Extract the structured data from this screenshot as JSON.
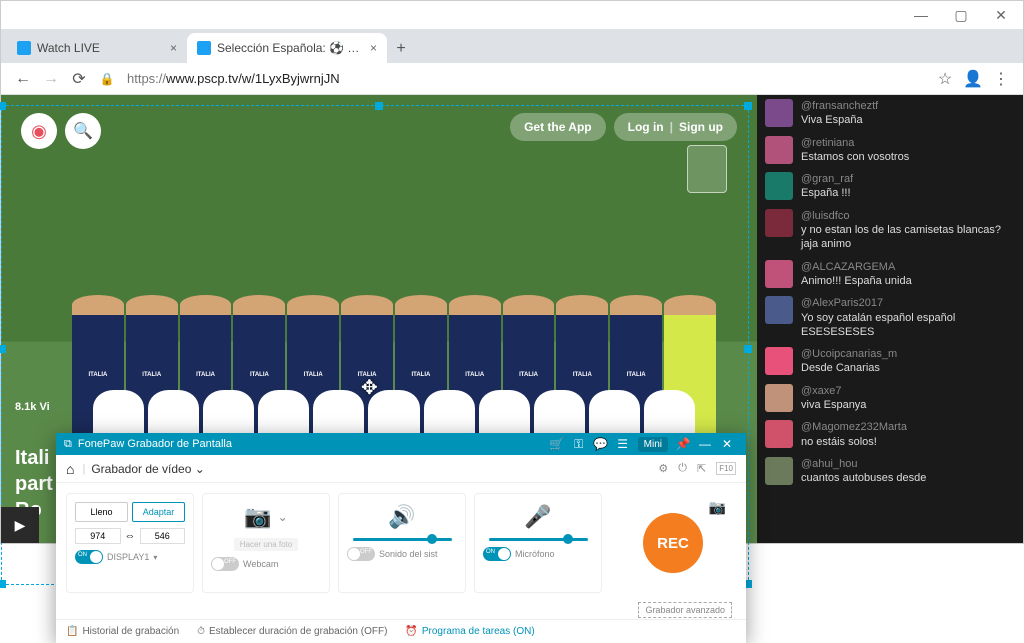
{
  "browser": {
    "tabs": [
      {
        "label": "Watch LIVE"
      },
      {
        "label": "Selección Española: ⚽ EN DI"
      }
    ],
    "url_proto": "https://",
    "url": "www.pscp.tv/w/1LyxByjwrnjJN"
  },
  "page": {
    "get_app": "Get the App",
    "login": "Log in",
    "signup": "Sign up",
    "viewers": "8.1k Vi",
    "title_line1": "Itali",
    "title_line2": "part",
    "title_line3": "Ro",
    "jersey": "ITALIA"
  },
  "chat": [
    {
      "user": "@fransancheztf",
      "body": "Viva España",
      "color": "#7a4a8a"
    },
    {
      "user": "@retiniana",
      "body": "Estamos con vosotros",
      "color": "#b0527a"
    },
    {
      "user": "@gran_raf",
      "body": "España !!!",
      "color": "#1a7a6a"
    },
    {
      "user": "@luisdfco",
      "body": "y no estan los de las camisetas blancas? jaja animo",
      "color": "#7a2a3a"
    },
    {
      "user": "@ALCAZARGEMA",
      "body": "Animo!!! España unida",
      "color": "#c0527a"
    },
    {
      "user": "@AlexParis2017",
      "body": "Yo soy catalán español español ESESESESES",
      "color": "#4a5a8a"
    },
    {
      "user": "@Ucoipcanarias_m",
      "body": "Desde Canarias",
      "color": "#e8527a"
    },
    {
      "user": "@xaxe7",
      "body": "viva Espanya",
      "color": "#c0927a"
    },
    {
      "user": "@Magomez232Marta",
      "body": "no estáis solos!",
      "color": "#d0526a"
    },
    {
      "user": "@ahui_hou",
      "body": "cuantos autobuses desde",
      "color": "#6a7a5a"
    }
  ],
  "recorder": {
    "title": "FonePaw Grabador de Pantalla",
    "mini": "Mini",
    "tab": "Grabador de vídeo",
    "display": {
      "lleno": "Lleno",
      "adaptar": "Adaptar",
      "width": "974",
      "height": "546",
      "link": "⇔",
      "on": "ON",
      "label": "DISPLAY1"
    },
    "webcam": {
      "off": "OFF",
      "label": "Webcam",
      "photo": "Hacer una foto"
    },
    "sound": {
      "off": "OFF",
      "label": "Sonido del sist"
    },
    "mic": {
      "on": "ON",
      "label": "Micrófono"
    },
    "rec": "REC",
    "advanced": "Grabador avanzado",
    "footer": {
      "history": "Historial de grabación",
      "duration": "Establecer duración de grabación (OFF)",
      "schedule": "Programa de tareas (ON)"
    }
  }
}
